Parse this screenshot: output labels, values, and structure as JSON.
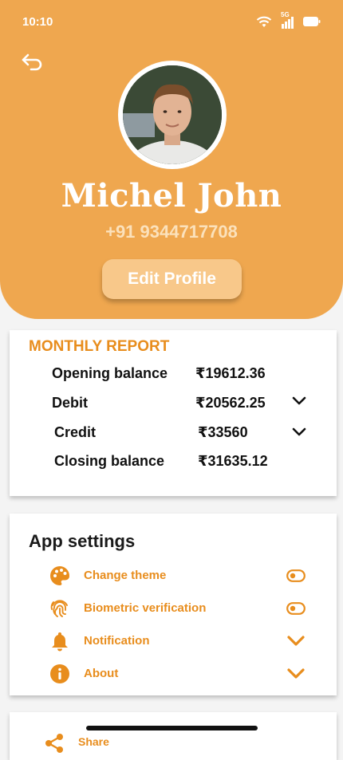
{
  "status": {
    "time": "10:10",
    "network": "5G"
  },
  "profile": {
    "name": "Michel John",
    "phone": "+91 9344717708",
    "edit_label": "Edit Profile"
  },
  "report": {
    "title": "MONTHLY REPORT",
    "rows": [
      {
        "label": "Opening balance",
        "value": "₹19612.36"
      },
      {
        "label": "Debit",
        "value": "₹20562.25"
      },
      {
        "label": "Credit",
        "value": "₹33560"
      },
      {
        "label": "Closing balance",
        "value": "₹31635.12"
      }
    ]
  },
  "settings": {
    "title": "App settings",
    "items": [
      {
        "label": "Change theme",
        "icon": "palette-icon",
        "control": "toggle",
        "state": "off"
      },
      {
        "label": "Biometric verification",
        "icon": "fingerprint-icon",
        "control": "toggle",
        "state": "off"
      },
      {
        "label": "Notification",
        "icon": "bell-icon",
        "control": "chevron"
      },
      {
        "label": "About",
        "icon": "info-icon",
        "control": "chevron"
      }
    ]
  },
  "share": {
    "label": "Share",
    "icon": "share-icon"
  },
  "colors": {
    "primary": "#efa74f",
    "accent": "#e88d1d",
    "button": "#f8c88a",
    "background": "#f4f4f4"
  }
}
